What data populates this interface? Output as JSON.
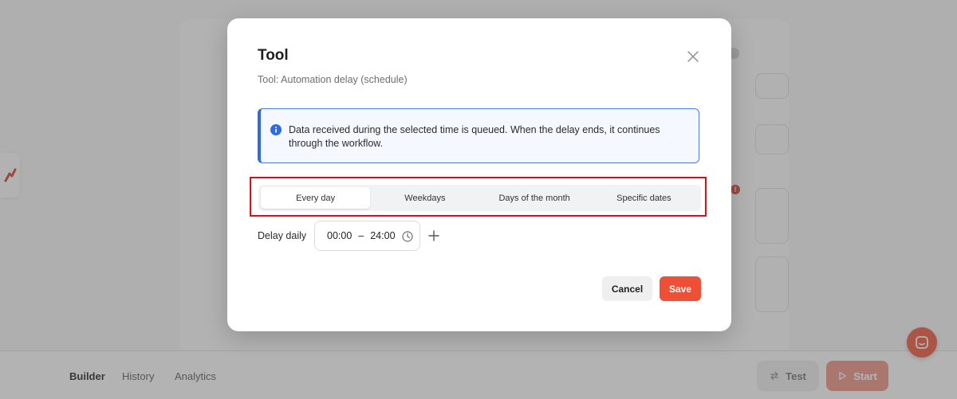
{
  "colors": {
    "accent": "#ee4f36",
    "start_button": "#ec8f80",
    "info_border": "#2f6ae0",
    "highlight_frame": "#e50914",
    "error_dot": "#d6392b"
  },
  "bottom_nav": {
    "tabs": [
      {
        "label": "Builder",
        "active": true
      },
      {
        "label": "History",
        "active": false
      },
      {
        "label": "Analytics",
        "active": false
      }
    ],
    "test_label": "Test",
    "start_label": "Start",
    "test_icon": "swap-arrows-icon",
    "start_icon": "play-icon"
  },
  "background": {
    "error_badge": "!",
    "side_icon": "brand-logo-icon",
    "help_icon": "chat-bubble-icon"
  },
  "modal": {
    "title": "Tool",
    "subtitle": "Tool: Automation delay (schedule)",
    "close_icon": "close-icon",
    "info": {
      "icon": "info-icon",
      "text": "Data received during the selected time is queued. When the delay ends, it continues through the workflow."
    },
    "schedule_tabs": [
      {
        "label": "Every day",
        "active": true
      },
      {
        "label": "Weekdays",
        "active": false
      },
      {
        "label": "Days of the month",
        "active": false
      },
      {
        "label": "Specific dates",
        "active": false
      }
    ],
    "delay": {
      "label": "Delay daily",
      "start": "00:00",
      "separator": "–",
      "end": "24:00",
      "clock_icon": "clock-icon",
      "add_icon": "plus-icon"
    },
    "cancel_label": "Cancel",
    "save_label": "Save"
  }
}
